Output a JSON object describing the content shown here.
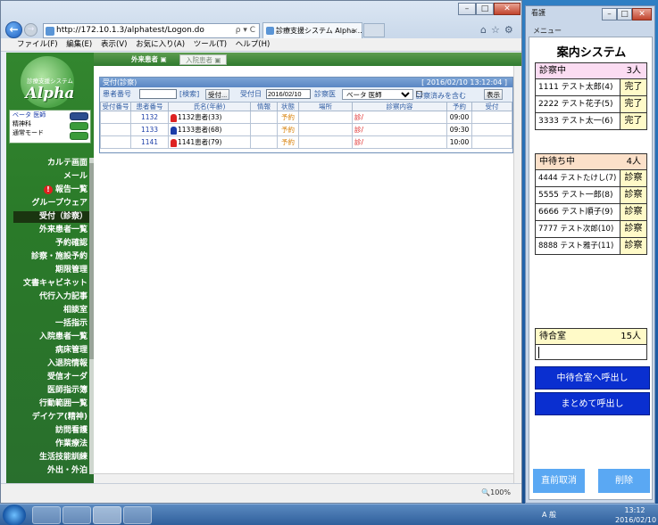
{
  "ie": {
    "address": "http://172.10.1.3/alphatest/Logon.do",
    "address_controls": "ρ ▾ C",
    "tab_title": "診療支援システム Alpha ...",
    "menu": [
      "ファイル(F)",
      "編集(E)",
      "表示(V)",
      "お気に入り(A)",
      "ツール(T)",
      "ヘルプ(H)"
    ],
    "zoom": "🔍100%"
  },
  "app": {
    "logo_text": "診療支援システム",
    "logo_name": "Alpha",
    "user": [
      "ベータ 医師",
      "精神科",
      "通常モード"
    ],
    "tabs": {
      "outpatient": "外来患者",
      "inpatient": "入院患者"
    },
    "sidebar_items": [
      "カルテ画面",
      "メール",
      "報告一覧",
      "グループウェア",
      "受付（診察）",
      "外来患者一覧",
      "予約確認",
      "診察・施設予約",
      "期限管理",
      "文書キャビネット",
      "代行入力記事",
      "相談室",
      "一括指示",
      "入院患者一覧",
      "病床管理",
      "入退院情報",
      "受信オーダ",
      "医師指示簿",
      "行動範囲一覧",
      "デイケア(精神)",
      "訪問看護",
      "作業療法",
      "生活技能訓練",
      "外出・外泊"
    ],
    "alert_mark": "!"
  },
  "panel": {
    "title": "受付(診察)",
    "timestamp": "[ 2016/02/10 13:12:04 ]",
    "labels": {
      "patient_no": "患者番号",
      "search": "[検索]",
      "reception_btn": "受付...",
      "reception_date": "受付日",
      "date_value": "2016/02/10",
      "doctor": "診察医",
      "doctor_value": "ベータ 医師",
      "include_done": "診察済みを含む",
      "display_btn": "表示"
    },
    "columns": [
      "受付番号",
      "患者番号",
      "氏名(年齢)",
      "情報",
      "状態",
      "場所",
      "診察内容",
      "予約",
      "受付"
    ],
    "rows": [
      {
        "reception": "",
        "patient": "1132",
        "name": "1132患者(33)",
        "sex": "f",
        "info": "",
        "status": "予約",
        "place": "",
        "content": "診/",
        "reserve": "09:00",
        "accept": ""
      },
      {
        "reception": "",
        "patient": "1133",
        "name": "1133患者(68)",
        "sex": "m",
        "info": "",
        "status": "予約",
        "place": "",
        "content": "診/",
        "reserve": "09:30",
        "accept": ""
      },
      {
        "reception": "",
        "patient": "1141",
        "name": "1141患者(79)",
        "sex": "f",
        "info": "",
        "status": "予約",
        "place": "",
        "content": "診/",
        "reserve": "10:00",
        "accept": ""
      }
    ]
  },
  "right_panel": {
    "window_title": "看護",
    "menu": "メニュー",
    "title": "案内システム",
    "in_exam": {
      "label": "診察中",
      "count": "3人",
      "rows": [
        {
          "name": "1111 テスト太郎(4)",
          "tag": "完了"
        },
        {
          "name": "2222 テスト花子(5)",
          "tag": "完了"
        },
        {
          "name": "3333 テスト太一(6)",
          "tag": "完了"
        }
      ]
    },
    "waiting": {
      "label": "中待ち中",
      "count": "4人",
      "rows": [
        {
          "name": "4444 テストたけし(7)",
          "tag": "診察"
        },
        {
          "name": "5555 テスト一郎(8)",
          "tag": "診察"
        },
        {
          "name": "6666 テスト順子(9)",
          "tag": "診察"
        },
        {
          "name": "7777 テスト次郎(10)",
          "tag": "診察"
        },
        {
          "name": "8888 テスト雅子(11)",
          "tag": "診察"
        }
      ]
    },
    "lobby": {
      "label": "待合室",
      "count": "15人"
    },
    "buttons": {
      "call_inner": "中待合室へ呼出し",
      "call_all": "まとめて呼出し",
      "undo": "直前取消",
      "delete": "削除"
    }
  },
  "taskbar": {
    "time": "13:12",
    "date": "2016/02/10",
    "ime": "A 般"
  }
}
